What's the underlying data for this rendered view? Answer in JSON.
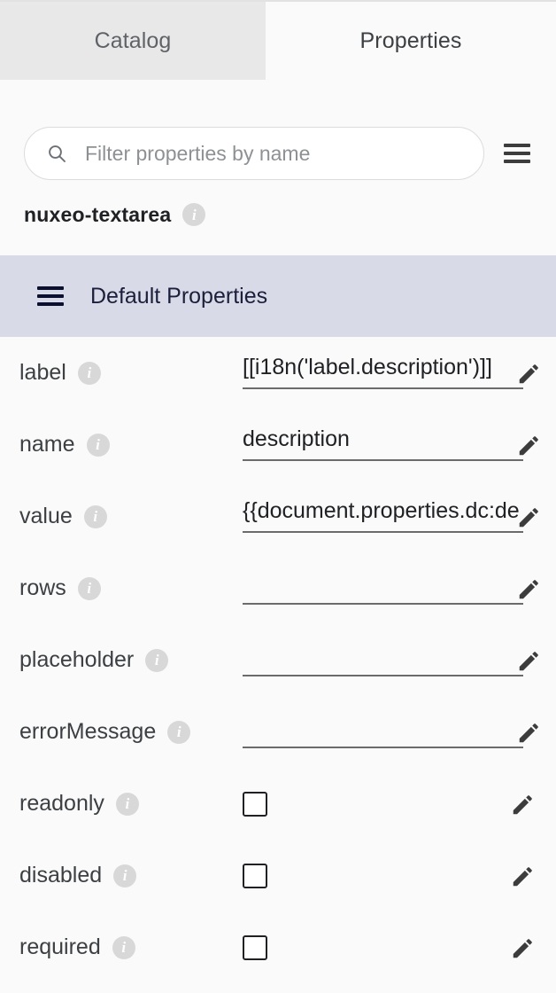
{
  "tabs": [
    {
      "label": "Catalog",
      "active": false,
      "name": "tab-catalog"
    },
    {
      "label": "Properties",
      "active": true,
      "name": "tab-properties"
    }
  ],
  "search": {
    "placeholder": "Filter properties by name",
    "value": "",
    "icon": "search-icon",
    "menu_icon": "hamburger-menu-icon"
  },
  "component": {
    "name": "nuxeo-textarea",
    "info_icon": "info-icon"
  },
  "section": {
    "title": "Default Properties",
    "menu_icon": "hamburger-menu-icon"
  },
  "properties": [
    {
      "label": "label",
      "type": "text",
      "value": "[[i18n('label.description')]]"
    },
    {
      "label": "name",
      "type": "text",
      "value": "description"
    },
    {
      "label": "value",
      "type": "text",
      "value": "{{document.properties.dc:description}}"
    },
    {
      "label": "rows",
      "type": "text",
      "value": ""
    },
    {
      "label": "placeholder",
      "type": "text",
      "value": ""
    },
    {
      "label": "errorMessage",
      "type": "text",
      "value": ""
    },
    {
      "label": "readonly",
      "type": "checkbox",
      "checked": false
    },
    {
      "label": "disabled",
      "type": "checkbox",
      "checked": false
    },
    {
      "label": "required",
      "type": "checkbox",
      "checked": false
    }
  ],
  "icons": {
    "edit": "pencil-edit-icon",
    "info": "info-icon"
  },
  "colors": {
    "tab_inactive_bg": "#e8e8e8",
    "page_bg": "#fafafa",
    "section_bg": "#d9dae8",
    "section_text": "#1b1f3b",
    "label_text": "#3c4043",
    "value_text": "#202124",
    "underline": "#6b6b6b",
    "info_badge": "#d8d8d8",
    "icon_dark": "#3c3c3c"
  }
}
